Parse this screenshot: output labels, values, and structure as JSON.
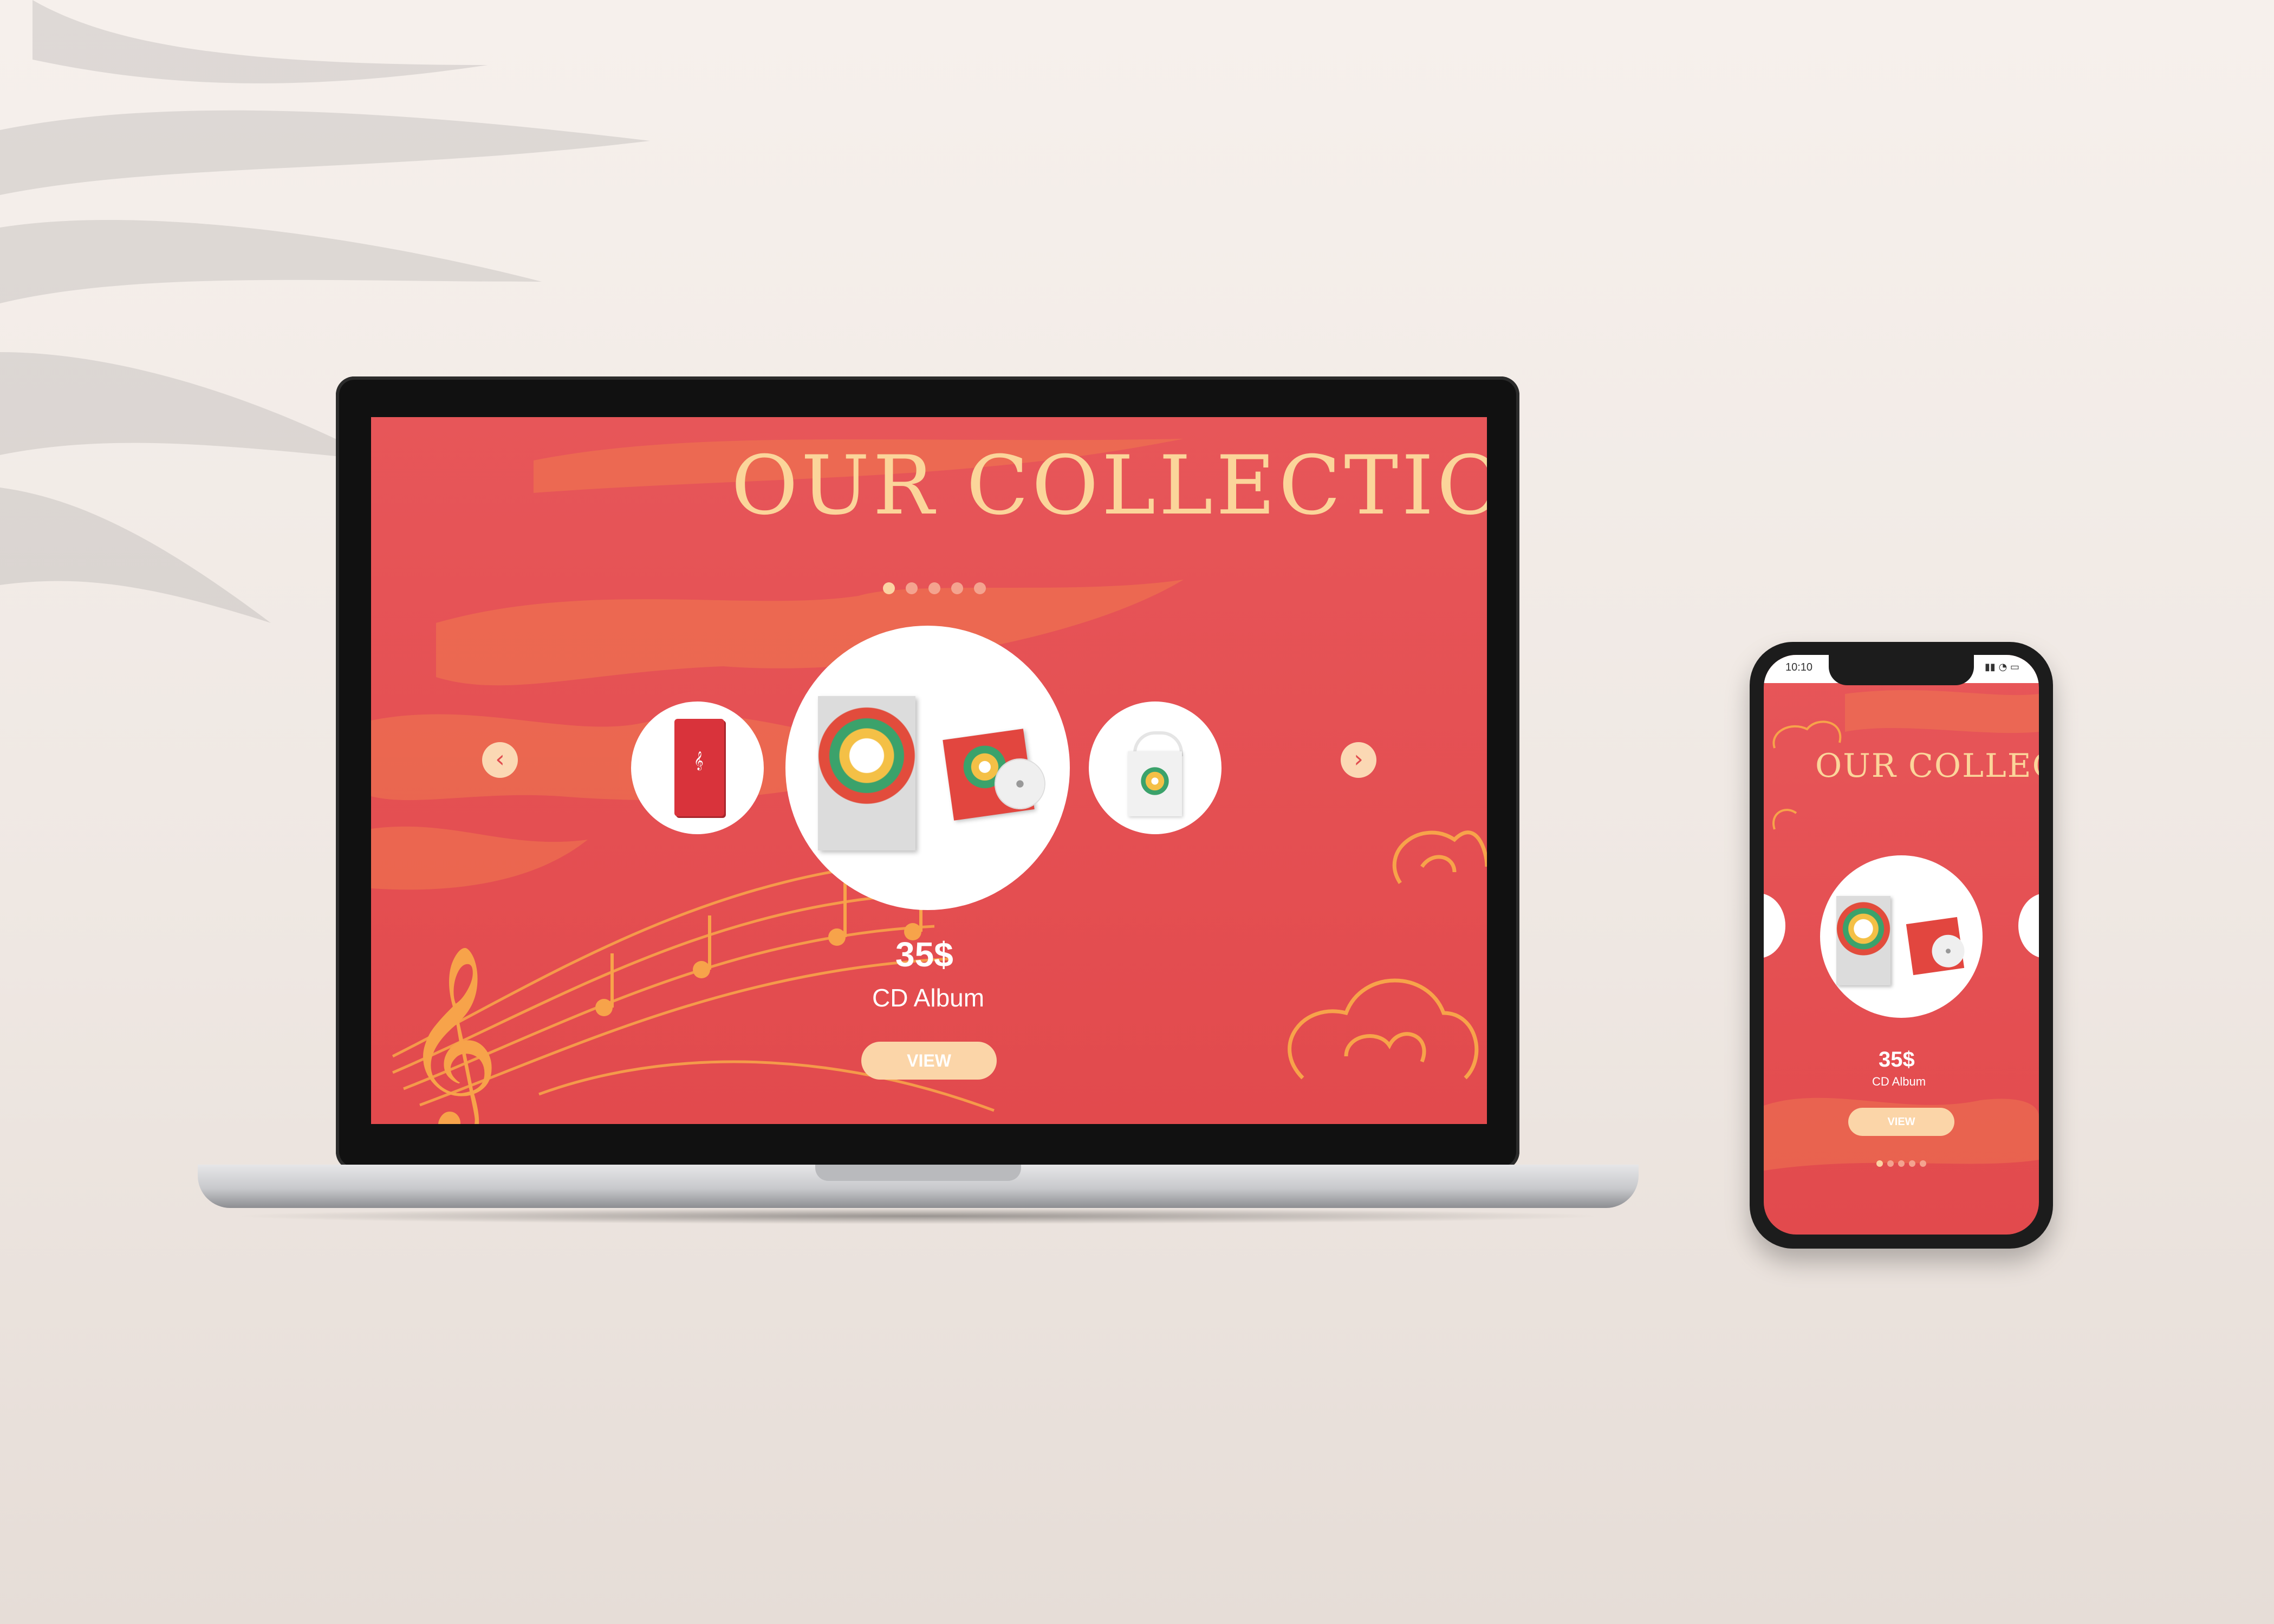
{
  "desktop": {
    "title": "OUR COLLECTION",
    "carousel": {
      "prev_icon": "‹",
      "next_icon": "›",
      "items": [
        "notebook",
        "cd-album",
        "tote-bag"
      ]
    },
    "featured": {
      "price": "35$",
      "name": "CD Album",
      "view_label": "VIEW"
    },
    "pagination": {
      "count": 5,
      "active": 1
    }
  },
  "mobile": {
    "status_time": "10:10",
    "title": "OUR COLLECTION",
    "featured": {
      "price": "35$",
      "name": "CD Album",
      "view_label": "VIEW"
    },
    "pagination": {
      "count": 5,
      "active": 1
    }
  },
  "colors": {
    "background": "#f3ece7",
    "screen_red": "#e4504f",
    "accent_gold": "#fbd59a",
    "button_peach": "#fbd5a8"
  }
}
